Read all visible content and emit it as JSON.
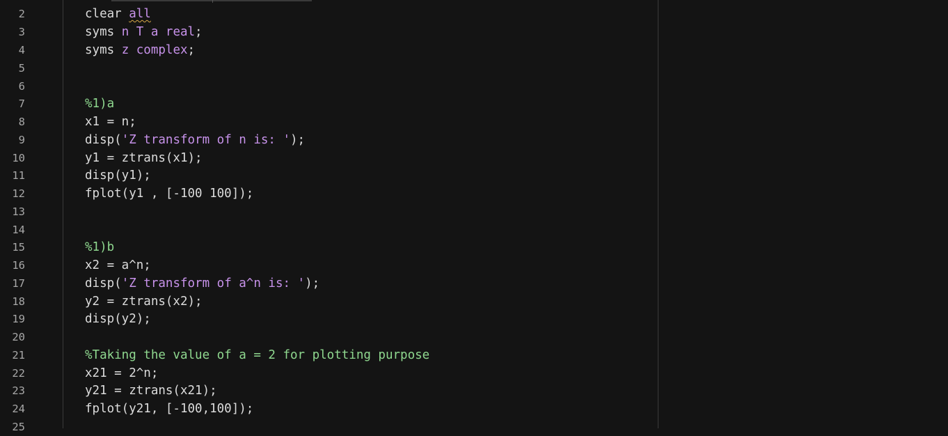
{
  "editor": {
    "line_numbers": [
      "2",
      "3",
      "4",
      "5",
      "6",
      "7",
      "8",
      "9",
      "10",
      "11",
      "12",
      "13",
      "14",
      "15",
      "16",
      "17",
      "18",
      "19",
      "20",
      "21",
      "22",
      "23",
      "24",
      "25"
    ],
    "lines": {
      "l2": {
        "a": "clear ",
        "b": "all"
      },
      "l3": {
        "a": "syms ",
        "b": "n T a real",
        "c": ";"
      },
      "l4": {
        "a": "syms ",
        "b": "z complex",
        "c": ";"
      },
      "l7": {
        "a": "%1)a"
      },
      "l8": {
        "a": "x1 = n;"
      },
      "l9": {
        "a": "disp(",
        "b": "'Z transform of n is: '",
        "c": ");"
      },
      "l10": {
        "a": "y1 = ztrans(x1);"
      },
      "l11": {
        "a": "disp(y1);"
      },
      "l12": {
        "a": "fplot(y1 , [-100 100]);"
      },
      "l15": {
        "a": "%1)b"
      },
      "l16": {
        "a": "x2 = a^n;"
      },
      "l17": {
        "a": "disp(",
        "b": "'Z transform of a^n is: '",
        "c": ");"
      },
      "l18": {
        "a": "y2 = ztrans(x2);"
      },
      "l19": {
        "a": "disp(y2);"
      },
      "l21": {
        "a": "%Taking the value of a = 2 for plotting purpose"
      },
      "l22": {
        "a": "x21 = 2^n;"
      },
      "l23": {
        "a": "y21 = ztrans(x21);"
      },
      "l24": {
        "a": "fplot(y21, [-100,100]);"
      }
    }
  },
  "colors": {
    "background": "#141414",
    "text": "#dcdcdc",
    "string_and_symbol": "#c792ea",
    "comment": "#8fd88f",
    "line_number": "#a8a8a8"
  }
}
